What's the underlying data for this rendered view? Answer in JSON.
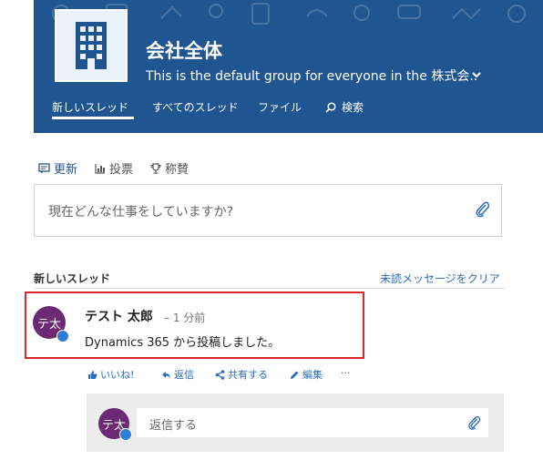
{
  "group": {
    "name": "会社全体",
    "description": "This is the default group for everyone in the 株式会.."
  },
  "tabs": [
    "新しいスレッド",
    "すべてのスレッド",
    "ファイル",
    "検索"
  ],
  "publisher": {
    "tabs": [
      "更新",
      "投票",
      "称賛"
    ],
    "placeholder": "現在どんな仕事をしていますか?"
  },
  "threads": {
    "title": "新しいスレッド",
    "mark_read": "未読メッセージをクリア"
  },
  "post": {
    "avatar_initials": "テ太",
    "author": "テスト 太郎",
    "time": "– 1 分前",
    "body": "Dynamics 365 から投稿しました。",
    "actions": [
      "いいね!",
      "返信",
      "共有する",
      "編集",
      "···"
    ]
  },
  "reply": {
    "avatar_initials": "テ太",
    "placeholder": "返信する"
  },
  "colors": {
    "banner": "#1f5591",
    "link": "#2a6cc0",
    "avatar": "#6b2a73",
    "highlight": "#e0262b"
  },
  "icons": {
    "logo": "building-icon",
    "description_toggle": "chevron-down-icon",
    "search": "search-icon",
    "update": "message-icon",
    "poll": "poll-icon",
    "praise": "trophy-icon",
    "attach": "paperclip-icon",
    "like": "thumbs-up-icon",
    "reply": "reply-icon",
    "share": "share-icon",
    "edit": "pencil-icon",
    "avatar_badge": "yammer-badge-icon"
  }
}
